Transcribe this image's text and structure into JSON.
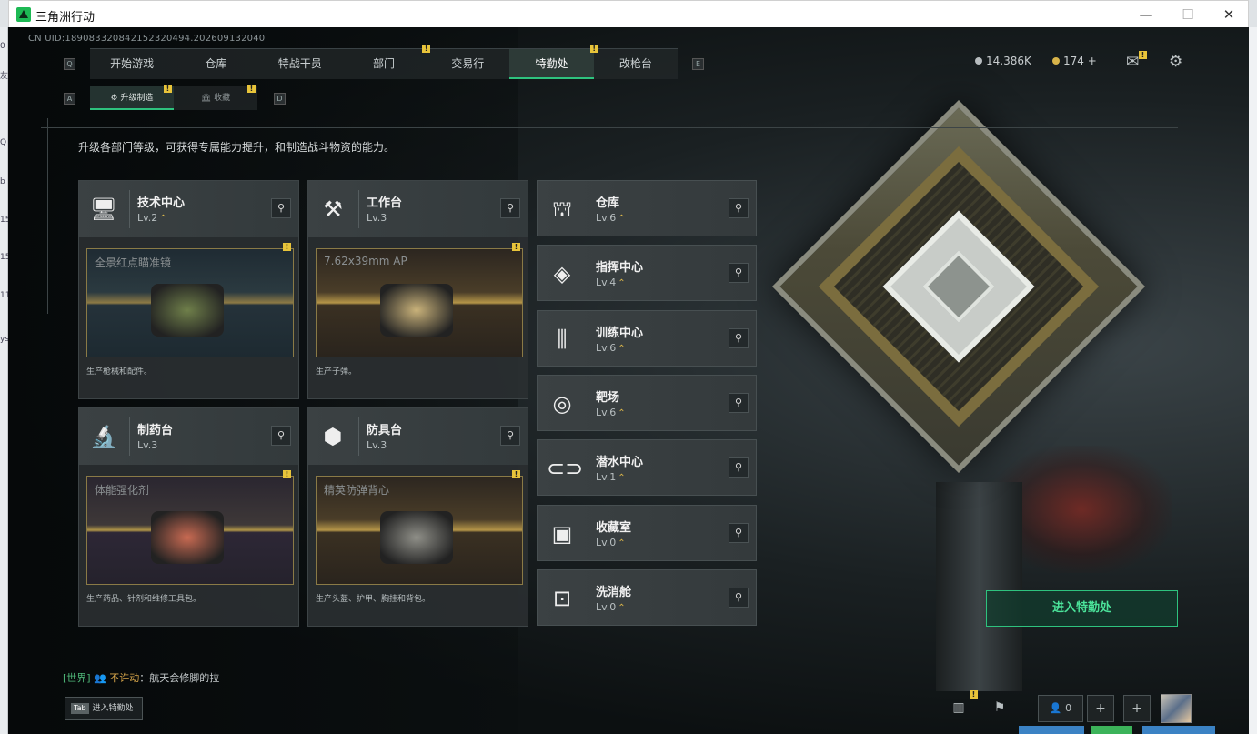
{
  "window": {
    "title": "三角洲行动",
    "minimize": "—",
    "maximize": "☐",
    "close": "✕"
  },
  "uid": "CN UID:1890833208421523​20494.202609132040",
  "top_nav": {
    "left_key": "Q",
    "right_key": "E",
    "tabs": [
      {
        "label": "开始游戏"
      },
      {
        "label": "仓库"
      },
      {
        "label": "特战干员"
      },
      {
        "label": "部门",
        "badge": "!"
      },
      {
        "label": "交易行"
      },
      {
        "label": "特勤处",
        "badge": "!",
        "active": true
      },
      {
        "label": "改枪台"
      }
    ]
  },
  "sub_nav": {
    "left_key": "A",
    "right_key": "D",
    "tabs": [
      {
        "label": "升级制造",
        "badge": "!",
        "active": true
      },
      {
        "label": "收藏",
        "badge": "!"
      }
    ]
  },
  "description": "升级各部门等级，可获得专属能力提升，和制造战斗物资的能力。",
  "currency": {
    "coins": "14,386K",
    "tickets": "174",
    "plus": "+"
  },
  "production_cards": [
    {
      "name": "技术中心",
      "level": "Lv.2",
      "has_chevron": true,
      "icon": "monitor-icon",
      "icon_glyph": "🖥",
      "preview_label": "全景红点瞄准镜",
      "preview_style": "blue",
      "object_color": "#6f7f4a",
      "badge": "!",
      "footer": "生产枪械和配件。"
    },
    {
      "name": "工作台",
      "level": "Lv.3",
      "has_chevron": false,
      "icon": "hammer-wrench-icon",
      "icon_glyph": "⚒",
      "preview_label": "7.62x39mm AP",
      "preview_style": "brown",
      "object_color": "#c9b27a",
      "badge": "!",
      "footer": "生产子弹。"
    },
    {
      "name": "制药台",
      "level": "Lv.3",
      "has_chevron": false,
      "icon": "microscope-icon",
      "icon_glyph": "🔬",
      "preview_label": "体能强化剂",
      "preview_style": "purple",
      "object_color": "#c86a52",
      "badge": "!",
      "footer": "生产药品、针剂和维修工具包。"
    },
    {
      "name": "防具台",
      "level": "Lv.3",
      "has_chevron": false,
      "icon": "armor-blocks-icon",
      "icon_glyph": "⬢",
      "preview_label": "精英防弹背心",
      "preview_style": "brown",
      "object_color": "#8f8f88",
      "badge": "!",
      "footer": "生产头盔、护甲、胸挂和背包。"
    }
  ],
  "facility_cards": [
    {
      "name": "仓库",
      "level": "Lv.6",
      "has_chevron": true,
      "icon": "warehouse-icon",
      "icon_glyph": "⛫"
    },
    {
      "name": "指挥中心",
      "level": "Lv.4",
      "has_chevron": true,
      "icon": "command-chip-icon",
      "icon_glyph": "◈"
    },
    {
      "name": "训练中心",
      "level": "Lv.6",
      "has_chevron": true,
      "icon": "dumbbell-icon",
      "icon_glyph": "⫼"
    },
    {
      "name": "靶场",
      "level": "Lv.6",
      "has_chevron": true,
      "icon": "target-icon",
      "icon_glyph": "◎"
    },
    {
      "name": "潜水中心",
      "level": "Lv.1",
      "has_chevron": true,
      "icon": "diving-mask-icon",
      "icon_glyph": "⊂⊃"
    },
    {
      "name": "收藏室",
      "level": "Lv.0",
      "has_chevron": true,
      "icon": "collection-room-icon",
      "icon_glyph": "▣"
    },
    {
      "name": "洗消舱",
      "level": "Lv.0",
      "has_chevron": true,
      "icon": "decon-chamber-icon",
      "icon_glyph": "⊡"
    }
  ],
  "chevron": "⌃",
  "search_glyph": "⚲",
  "enter_button": "进入特勤处",
  "chat": {
    "channel": "[世界]",
    "user": "不许动",
    "message": "：航天会修脚的拉"
  },
  "tab_hint": {
    "key": "Tab",
    "label": "进入特勤处"
  },
  "bottom_bar": {
    "friends_count": "0",
    "plus": "+"
  },
  "colors": {
    "accent": "#2ec27e",
    "badge": "#e8c43a",
    "chevron": "#d8b44a"
  }
}
